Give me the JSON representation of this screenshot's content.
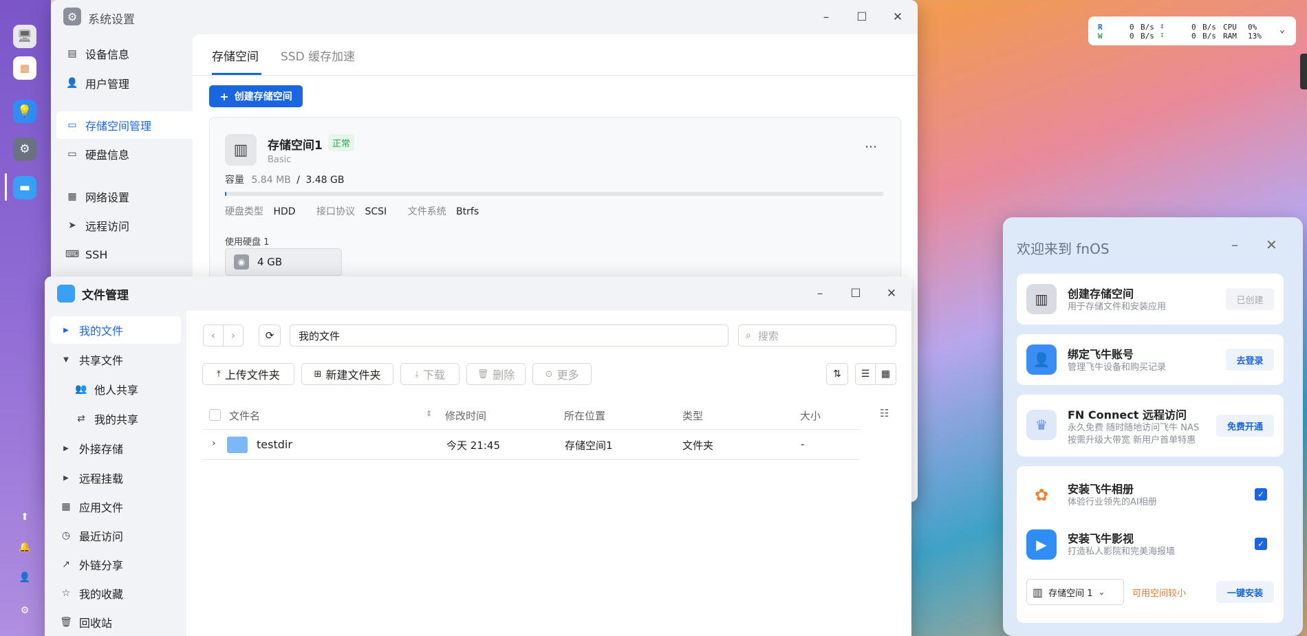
{
  "perf": {
    "r_label": "R",
    "w_label": "W",
    "r_val": "0",
    "w_val": "0",
    "r_unit": "B/s",
    "w_unit": "B/s",
    "up_val": "0",
    "down_val": "0",
    "up_unit": "B/s",
    "down_unit": "B/s",
    "cpu_label": "CPU",
    "ram_label": "RAM",
    "cpu_val": "0%",
    "ram_val": "13%"
  },
  "settings": {
    "title": "系统设置",
    "nav": [
      "设备信息",
      "用户管理",
      "存储空间管理",
      "硬盘信息",
      "网络设置",
      "远程访问",
      "SSH"
    ],
    "tabs": [
      "存储空间",
      "SSD 缓存加速"
    ],
    "create_btn": "创建存储空间",
    "pool": {
      "name": "存储空间1",
      "status": "正常",
      "type": "Basic",
      "capacity_label": "容量",
      "used": "5.84 MB",
      "sep": "/",
      "total": "3.48 GB",
      "usage_fraction": 0.002,
      "disk_type_label": "硬盘类型",
      "disk_type": "HDD",
      "iface_label": "接口协议",
      "iface": "SCSI",
      "fs_label": "文件系统",
      "fs": "Btrfs",
      "used_disks_label": "使用硬盘 1",
      "disk_size": "4 GB"
    }
  },
  "files": {
    "title": "文件管理",
    "nav": [
      "我的文件",
      "共享文件",
      "他人共享",
      "我的共享",
      "外接存储",
      "远程挂载",
      "应用文件",
      "最近访问",
      "外链分享",
      "我的收藏",
      "回收站"
    ],
    "path": "我的文件",
    "search_placeholder": "搜索",
    "toolbar": {
      "upload": "上传文件夹",
      "new_folder": "新建文件夹",
      "download": "下载",
      "delete": "删除",
      "more": "更多"
    },
    "columns": {
      "name": "文件名",
      "modified": "修改时间",
      "location": "所在位置",
      "type": "类型",
      "size": "大小"
    },
    "rows": [
      {
        "name": "testdir",
        "modified": "今天 21:45",
        "location": "存储空间1",
        "type": "文件夹",
        "size": "-"
      }
    ]
  },
  "welcome": {
    "title": "欢迎来到 fnOS",
    "cards": [
      {
        "title": "创建存储空间",
        "sub": "用于存储文件和安装应用",
        "action": "已创建"
      },
      {
        "title": "绑定飞牛账号",
        "sub": "管理飞牛设备和购买记录",
        "action": "去登录"
      },
      {
        "title": "FN Connect 远程访问",
        "sub1": "永久免费 随时随地访问飞牛 NAS",
        "sub2": "按需升级大带宽 新用户首单特惠",
        "action": "免费开通"
      }
    ],
    "apps": [
      {
        "title": "安装飞牛相册",
        "sub": "体验行业领先的AI相册"
      },
      {
        "title": "安装飞牛影视",
        "sub": "打造私人影院和完美海报墙"
      }
    ],
    "target": "存储空间 1",
    "warn": "可用空间较小",
    "install_btn": "一键安装"
  }
}
